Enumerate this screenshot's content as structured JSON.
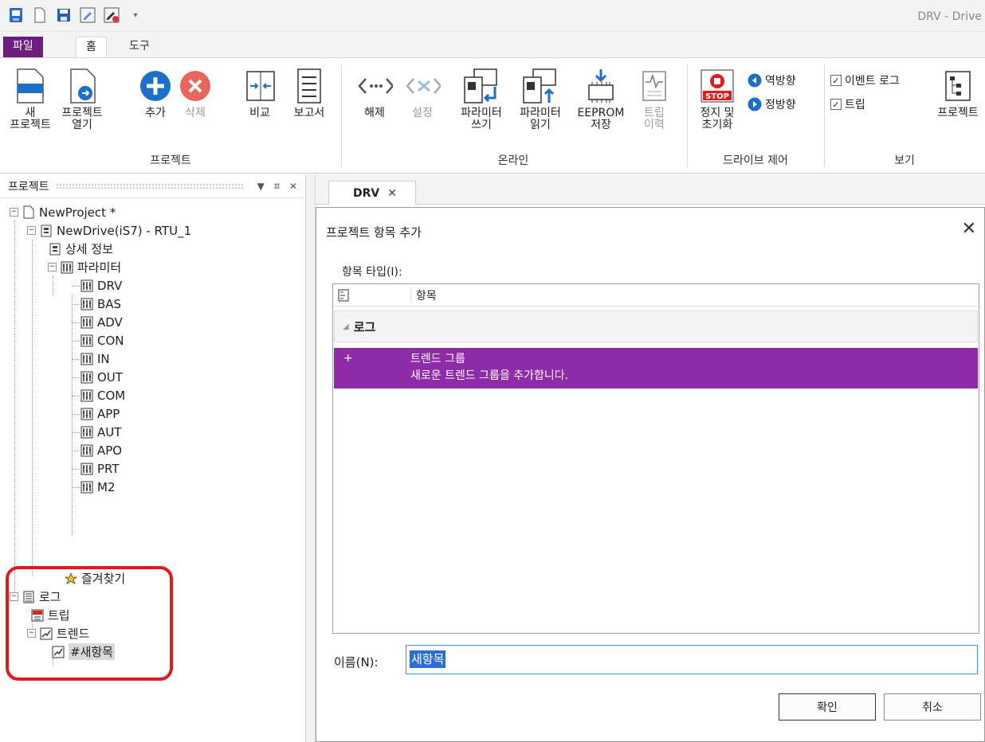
{
  "app": {
    "title": "DRV - Drive",
    "menu": {
      "file": "파일",
      "home": "홈",
      "tools": "도구"
    }
  },
  "ribbon": {
    "project": {
      "new_project": "새\n프로젝트",
      "open_project": "프로젝트\n열기",
      "add": "추가",
      "delete": "삭제",
      "compare": "비교",
      "report": "보고서",
      "group": "프로젝트"
    },
    "online": {
      "release": "해제",
      "setup": "설정",
      "param_write": "파라미터\n쓰기",
      "param_read": "파라미터\n읽기",
      "eeprom_save": "EEPROM\n저장",
      "trip_history": "트립\n이력",
      "group": "온라인"
    },
    "drive": {
      "stop_reset": "정지 및\n초기화",
      "reverse": "역방향",
      "forward": "정방향",
      "stop_text": "STOP",
      "group": "드라이브 제어"
    },
    "view": {
      "event_log": "이벤트 로그",
      "trip": "트립",
      "project": "프로젝트",
      "group": "보기"
    }
  },
  "panel": {
    "title": "프로젝트",
    "pin": "ㅍ",
    "close": "✕",
    "tree": {
      "root": "NewProject *",
      "drive": "NewDrive(iS7) - RTU_1",
      "detail": "상세 정보",
      "params": "파라미터",
      "param_groups": [
        "DRV",
        "BAS",
        "ADV",
        "CON",
        "IN",
        "OUT",
        "COM",
        "APP",
        "AUT",
        "APO",
        "PRT",
        "M2"
      ],
      "favorites": "즐겨찾기",
      "log": "로그",
      "trip": "트립",
      "trend": "트렌드",
      "new_item": "#새항목"
    }
  },
  "doc_tab": {
    "label": "DRV",
    "close": "✕"
  },
  "dialog": {
    "title": "프로젝트 항목 추가",
    "close": "✕",
    "type_label": "항목 타입(I):",
    "col_item": "항목",
    "group": "로그",
    "item_plus": "+",
    "item_name": "트렌드 그룹",
    "item_desc": "새로운 트렌드 그룹을 추가합니다.",
    "name_label": "이름(N):",
    "name_value": "새항목",
    "ok": "확인",
    "cancel": "취소"
  },
  "colors": {
    "accent": "#8e2ba6",
    "file_tab": "#6b1f7c",
    "highlight": "#e4191d",
    "selection": "#2c6fd2"
  }
}
